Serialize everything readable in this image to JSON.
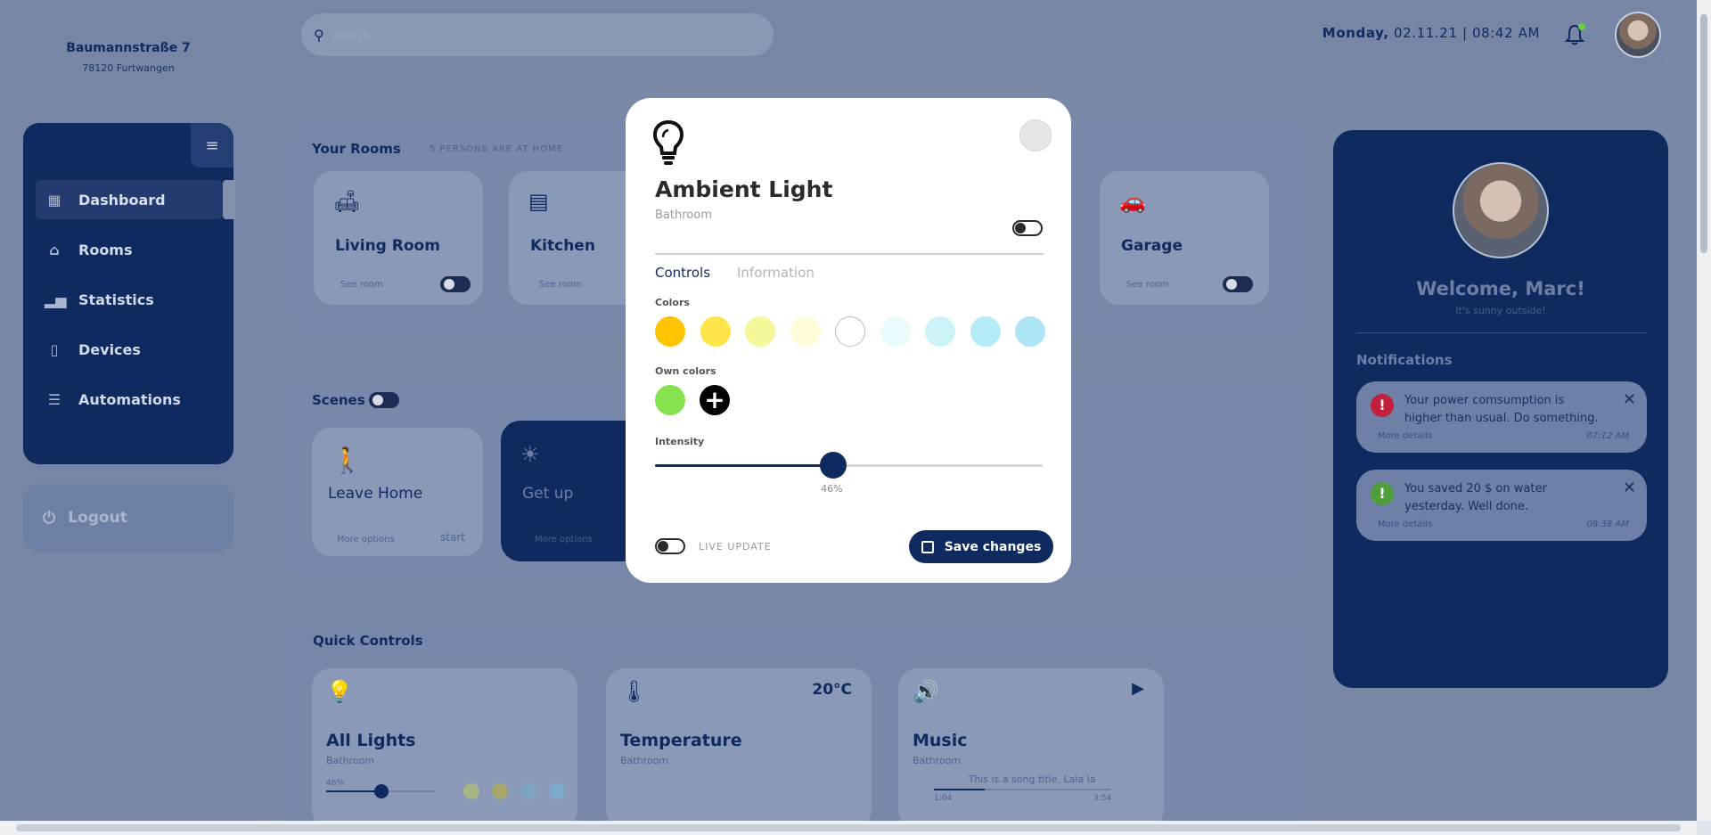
{
  "address": {
    "street": "Baumannstraße 7",
    "city": "78120 Furtwangen"
  },
  "nav": {
    "items": [
      {
        "label": "Dashboard",
        "icon": "grid-icon"
      },
      {
        "label": "Rooms",
        "icon": "home-icon"
      },
      {
        "label": "Statistics",
        "icon": "chart-icon"
      },
      {
        "label": "Devices",
        "icon": "phone-icon"
      },
      {
        "label": "Automations",
        "icon": "sliders-icon"
      }
    ],
    "logout": "Logout"
  },
  "search": {
    "placeholder": "Search"
  },
  "datetime": {
    "day": "Monday,",
    "rest": "02.11.21 | 08:42 AM"
  },
  "rooms": {
    "title": "Your Rooms",
    "persons": "5 PERSONS ARE AT HOME",
    "cards": [
      {
        "name": "Living Room",
        "see": "See room"
      },
      {
        "name": "Kitchen",
        "see": "See room"
      },
      {
        "name": "Garage",
        "see": "See room"
      }
    ]
  },
  "scenes": {
    "title": "Scenes",
    "cards": [
      {
        "name": "Leave Home",
        "more": "More options",
        "start": "start"
      },
      {
        "name": "Get up",
        "more": "More options"
      }
    ]
  },
  "quick": {
    "title": "Quick Controls",
    "lights": {
      "name": "All Lights",
      "room": "Bathroom",
      "percent": "46%"
    },
    "temperature": {
      "name": "Temperature",
      "room": "Bathroom",
      "value": "20°C"
    },
    "music": {
      "name": "Music",
      "room": "Bathroom",
      "song": "This is a song title. Lala la",
      "elapsed": "1:04",
      "total": "3:54",
      "progress": 0.29
    }
  },
  "profile": {
    "welcome": "Welcome, Marc!",
    "weather": "It's sunny outside!",
    "notifications_title": "Notifications",
    "notifications": [
      {
        "text": "Your power comsumption is higher than usual. Do something.",
        "more": "More details",
        "time": "07:12 AM",
        "color": "#c0203b",
        "icon": "alert-icon"
      },
      {
        "text": "You saved 20 $ on water yesterday. Well done.",
        "more": "More details",
        "time": "08:38 AM",
        "color": "#4f9d3a",
        "icon": "check-alert-icon"
      }
    ]
  },
  "modal": {
    "title": "Ambient Light",
    "room": "Bathroom",
    "tabs": [
      "Controls",
      "Information"
    ],
    "colors_label": "Colors",
    "colors": [
      "#ffc400",
      "#ffe44a",
      "#f4f79a",
      "#fdfbd8",
      "#ffffff",
      "#e9fbfd",
      "#ccf4f8",
      "#b3ecf7",
      "#aee5f6"
    ],
    "own_label": "Own colors",
    "own_colors": [
      "#86e24e"
    ],
    "intensity_label": "Intensity",
    "intensity": 46,
    "intensity_text": "46%",
    "live_update": "LIVE UPDATE",
    "save": "Save changes"
  }
}
